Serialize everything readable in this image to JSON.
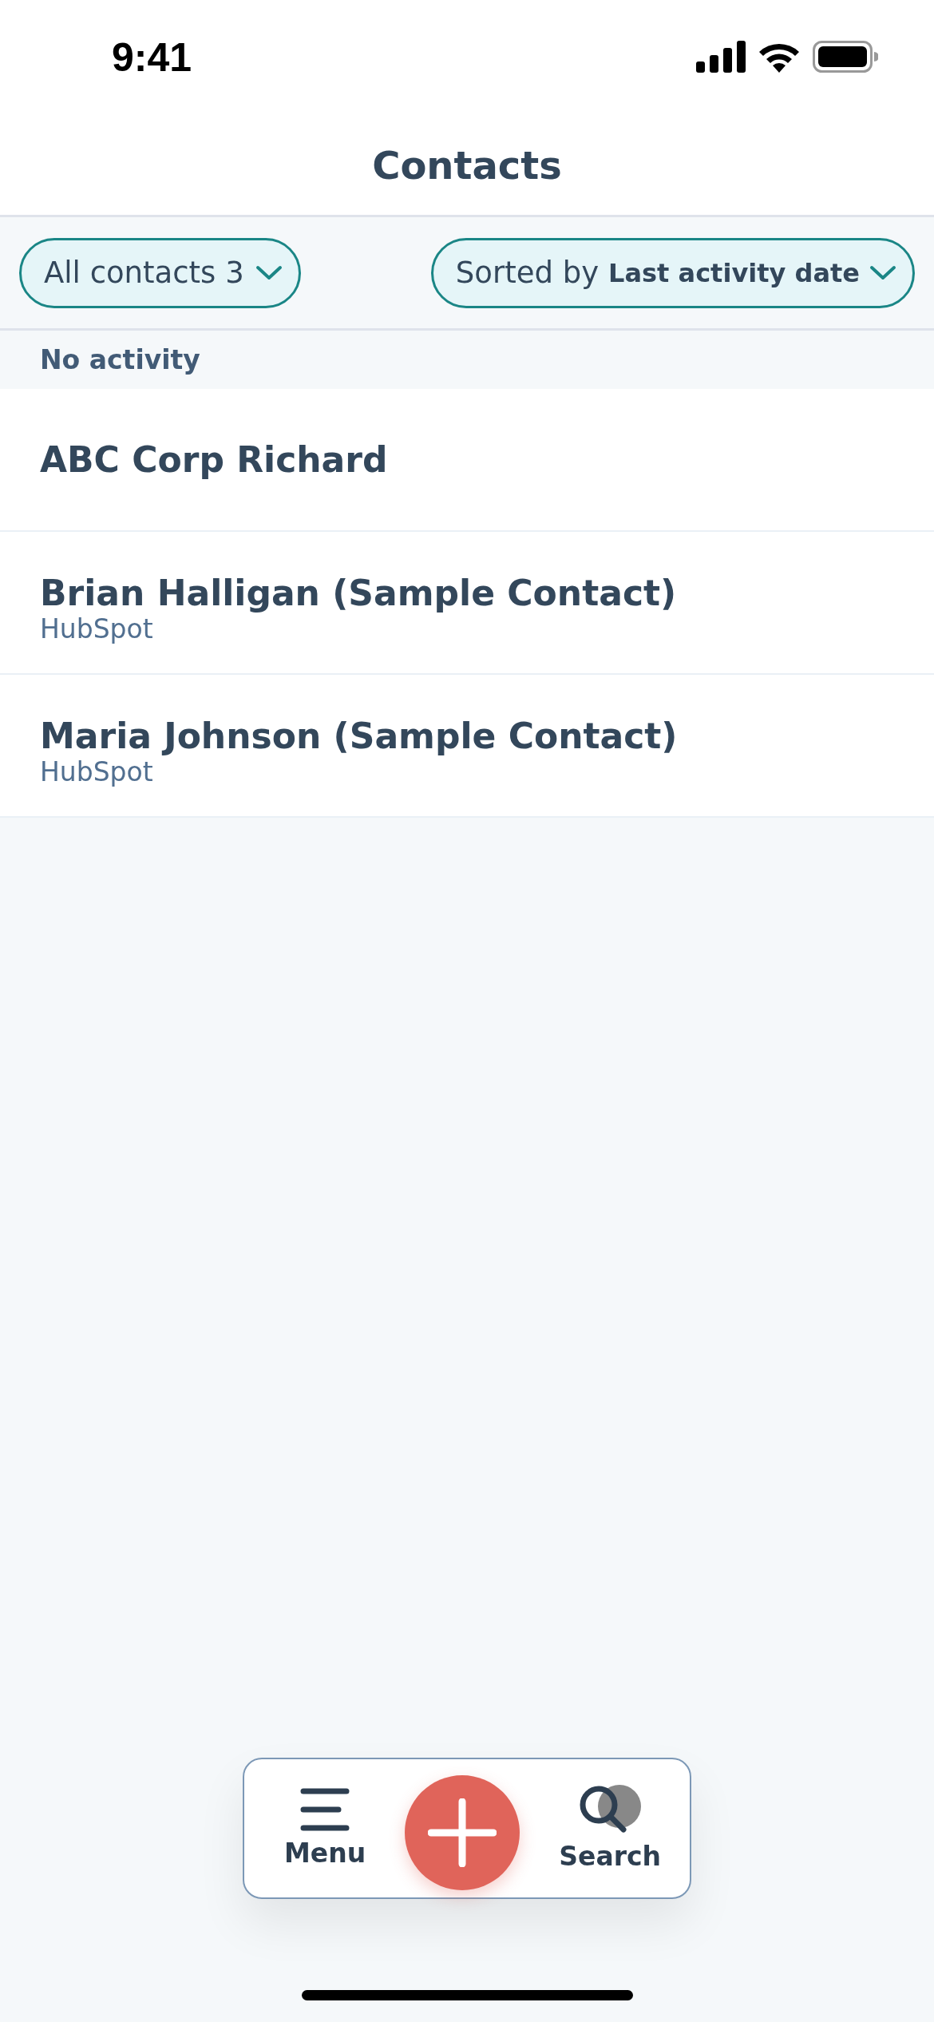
{
  "status_bar": {
    "time": "9:41"
  },
  "header": {
    "title": "Contacts"
  },
  "filters": [
    {
      "label": "All contacts 3"
    },
    {
      "label": "Sorted by",
      "value": "Last activity date"
    }
  ],
  "section": {
    "title": "No activity",
    "contacts": [
      {
        "name": "ABC Corp Richard"
      },
      {
        "name": "Brian Halligan (Sample Contact)",
        "company": "HubSpot"
      },
      {
        "name": "Maria Johnson (Sample Contact)",
        "company": "HubSpot"
      }
    ]
  },
  "tab_bar": [
    {
      "kind": "menu",
      "label": "Menu"
    },
    {
      "kind": "add"
    },
    {
      "kind": "search",
      "label": "Search"
    }
  ]
}
